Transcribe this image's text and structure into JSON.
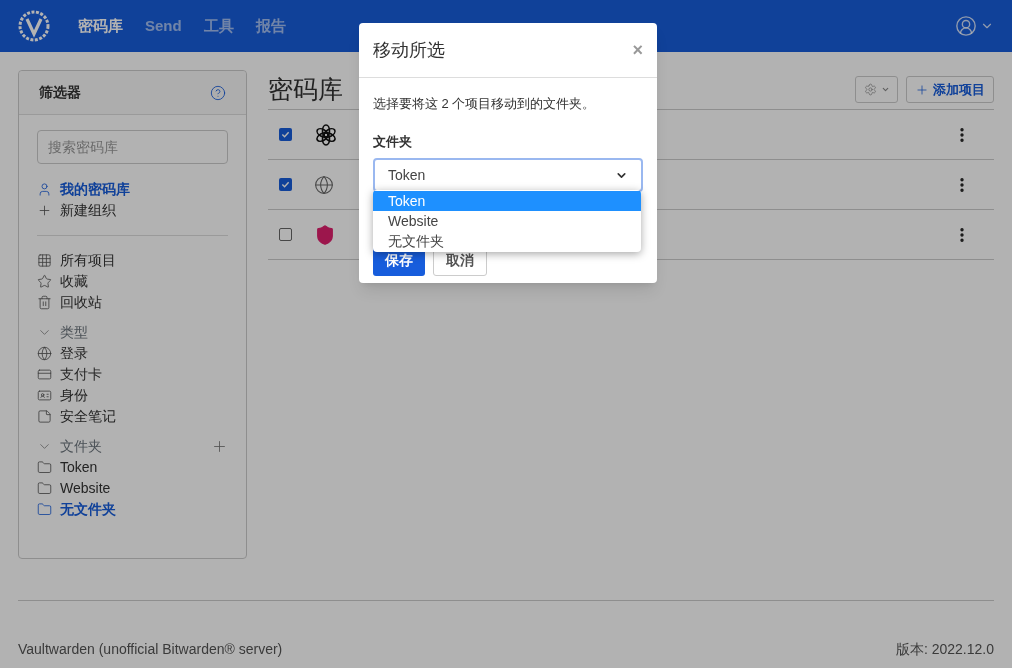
{
  "navbar": {
    "items": [
      {
        "label": "密码库",
        "selected": true
      },
      {
        "label": "Send",
        "selected": false
      },
      {
        "label": "工具",
        "selected": false
      },
      {
        "label": "报告",
        "selected": false
      }
    ]
  },
  "sidebar": {
    "title": "筛选器",
    "search": {
      "placeholder": "搜索密码库"
    },
    "vaults": [
      {
        "label": "我的密码库",
        "selected": true
      },
      {
        "label": "新建组织",
        "selected": false
      }
    ],
    "collections": [
      {
        "label": "所有项目",
        "selected": false
      },
      {
        "label": "收藏",
        "selected": false
      },
      {
        "label": "回收站",
        "selected": false
      }
    ],
    "types": {
      "label": "类型",
      "expanded": true,
      "items": [
        {
          "label": "登录",
          "selected": false
        },
        {
          "label": "支付卡",
          "selected": false
        },
        {
          "label": "身份",
          "selected": false
        },
        {
          "label": "安全笔记",
          "selected": false
        }
      ]
    },
    "folders": {
      "label": "文件夹",
      "expanded": true,
      "items": [
        {
          "label": "Token",
          "selected": false
        },
        {
          "label": "Website",
          "selected": false
        },
        {
          "label": "无文件夹",
          "selected": true
        }
      ]
    }
  },
  "main": {
    "heading": "密码库",
    "add_button": "添加项目",
    "rows": [
      {
        "checked": true
      },
      {
        "checked": true
      },
      {
        "checked": false
      }
    ]
  },
  "footer": {
    "left": "Vaultwarden (unofficial Bitwarden® server)",
    "right": "版本: 2022.12.0"
  },
  "modal": {
    "title": "移动所选",
    "close": "×",
    "message": "选择要将这 2 个项目移动到的文件夹。",
    "field_label": "文件夹",
    "value": "Token",
    "options": [
      {
        "label": "Token",
        "selected": true
      },
      {
        "label": "Website",
        "selected": false
      },
      {
        "label": "无文件夹",
        "selected": false
      }
    ],
    "buttons": [
      "保存",
      "取消"
    ]
  }
}
